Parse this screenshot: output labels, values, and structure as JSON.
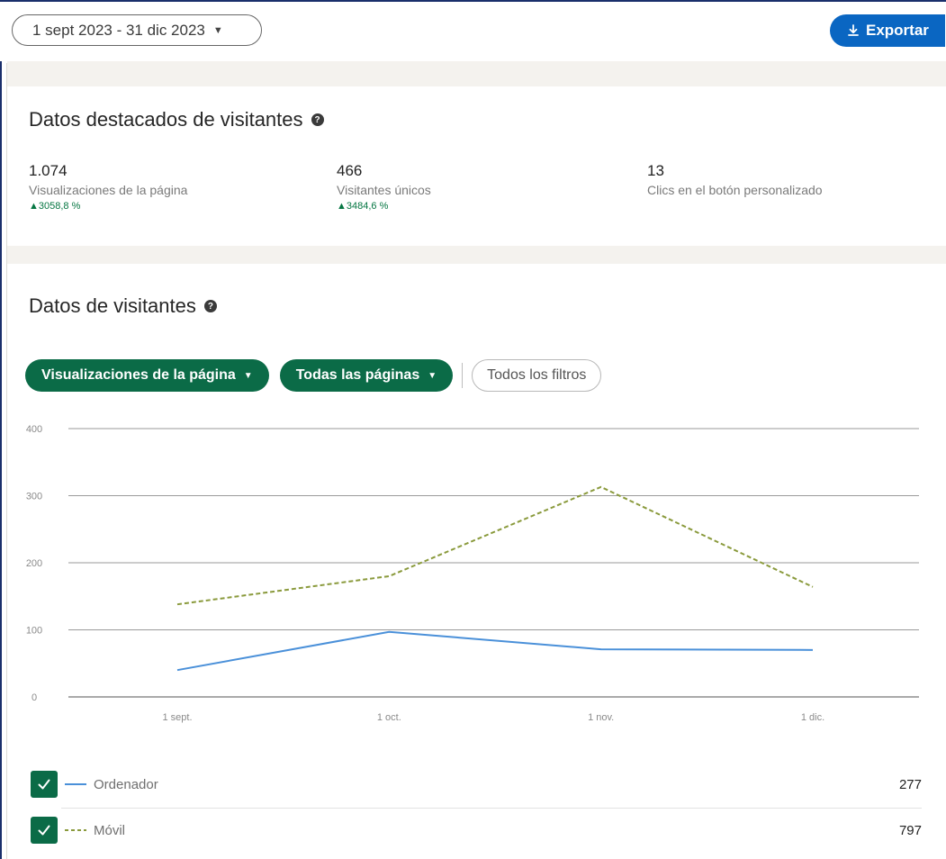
{
  "toolbar": {
    "date_range": "1 sept 2023 - 31 dic 2023",
    "export_label": "Exportar"
  },
  "highlights": {
    "title": "Datos destacados de visitantes",
    "metrics": [
      {
        "value": "1.074",
        "label": "Visualizaciones de la página",
        "change": "▲3058,8 %"
      },
      {
        "value": "466",
        "label": "Visitantes únicos",
        "change": "▲3484,6 %"
      },
      {
        "value": "13",
        "label": "Clics en el botón personalizado",
        "change": ""
      }
    ]
  },
  "visitors": {
    "title": "Datos de visitantes",
    "filters": {
      "metric": "Visualizaciones de la página",
      "pages": "Todas las páginas",
      "all_filters": "Todos los filtros"
    }
  },
  "chart_data": {
    "type": "line",
    "categories": [
      "1 sept.",
      "1 oct.",
      "1 nov.",
      "1 dic."
    ],
    "y_ticks": [
      "0",
      "100",
      "200",
      "300",
      "400"
    ],
    "ylim": [
      0,
      400
    ],
    "grid": true,
    "series": [
      {
        "name": "Ordenador",
        "values": [
          40,
          97,
          71,
          70
        ],
        "color": "#4a90d9",
        "style": "solid",
        "total": "277"
      },
      {
        "name": "Móvil",
        "values": [
          138,
          180,
          313,
          164
        ],
        "color": "#8a9a3c",
        "style": "dashed",
        "total": "797"
      }
    ]
  },
  "colors": {
    "accent_blue": "#0a66c2",
    "accent_green": "#0b6b47",
    "positive": "#057642"
  }
}
